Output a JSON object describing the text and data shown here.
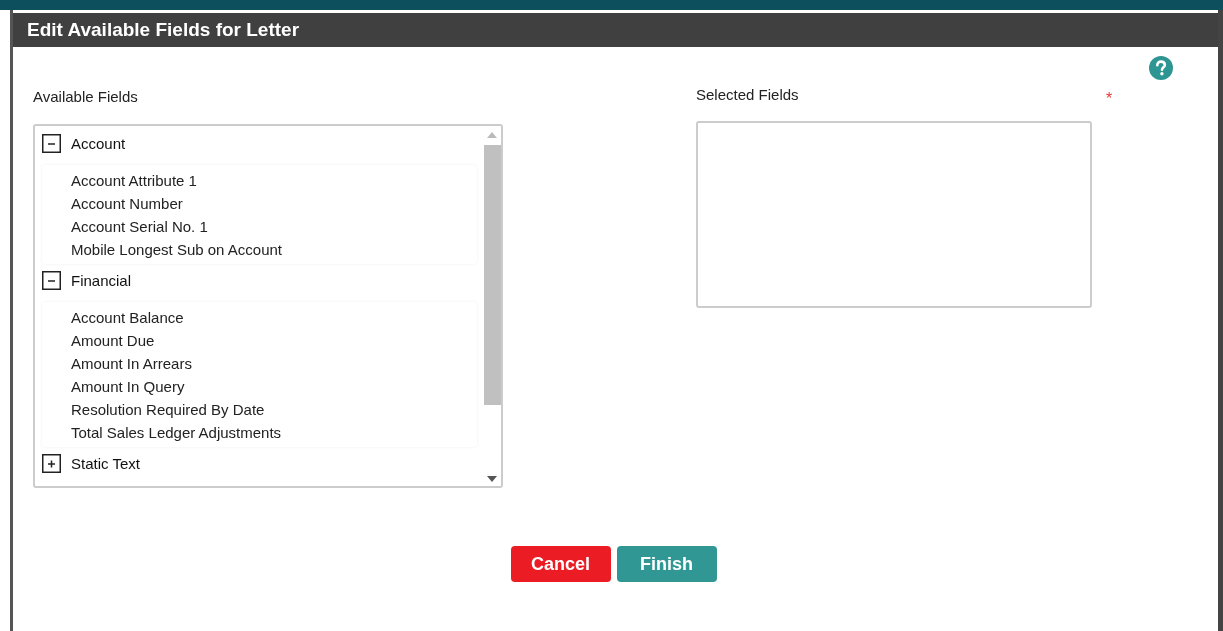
{
  "dialog": {
    "title": "Edit Available Fields for Letter"
  },
  "available": {
    "label": "Available Fields",
    "groups": [
      {
        "name": "Account",
        "expanded": true,
        "items": [
          "Account Attribute 1",
          "Account Number",
          "Account Serial No. 1",
          "Mobile Longest Sub on Account"
        ]
      },
      {
        "name": "Financial",
        "expanded": true,
        "items": [
          "Account Balance",
          "Amount Due",
          "Amount In Arrears",
          "Amount In Query",
          "Resolution Required By Date",
          "Total Sales Ledger Adjustments"
        ]
      },
      {
        "name": "Static Text",
        "expanded": false
      }
    ]
  },
  "selected": {
    "label": "Selected Fields",
    "required_mark": "*"
  },
  "buttons": [
    {
      "label": "Cancel",
      "kind": "cancel"
    },
    {
      "label": "Finish",
      "kind": "primary"
    }
  ]
}
